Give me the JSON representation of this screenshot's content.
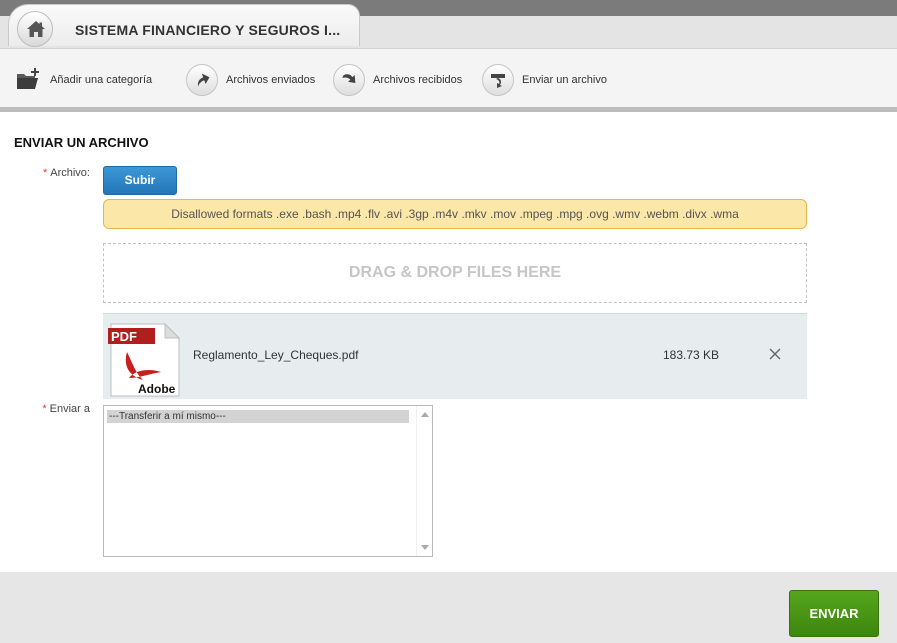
{
  "header": {
    "app_title": "SISTEMA FINANCIERO Y SEGUROS I...",
    "home_icon": "home-icon"
  },
  "toolbar": {
    "items": [
      {
        "label": "Añadir una categoría",
        "icon": "folder-add-icon"
      },
      {
        "label": "Archivos enviados",
        "icon": "arrow-up-icon"
      },
      {
        "label": "Archivos recibidos",
        "icon": "arrow-down-icon"
      },
      {
        "label": "Enviar un archivo",
        "icon": "send-file-icon"
      }
    ]
  },
  "form": {
    "title": "ENVIAR UN ARCHIVO",
    "required_mark": "*",
    "archivo_label": "Archivo:",
    "upload_button": "Subir",
    "warning": "Disallowed formats .exe .bash .mp4 .flv .avi .3gp .m4v .mkv .mov .mpeg .mpg .ovg .wmv .webm .divx .wma",
    "dropzone_text": "DRAG & DROP FILES HERE",
    "file": {
      "name": "Reglamento_Ley_Cheques.pdf",
      "size": "183.73 KB",
      "icon": "pdf-file-icon",
      "icon_badge": "PDF",
      "icon_brand": "Adobe"
    },
    "enviar_a_label": "Enviar a",
    "enviar_a_options": [
      "---Transferir a mí mismo---"
    ]
  },
  "footer": {
    "send_button": "ENVIAR"
  },
  "colors": {
    "upload_button": "#2a84c6",
    "send_button": "#4a9a16",
    "warning_bg": "#fbe7a8",
    "warning_border": "#e6b84a",
    "required": "#e03b2b"
  }
}
